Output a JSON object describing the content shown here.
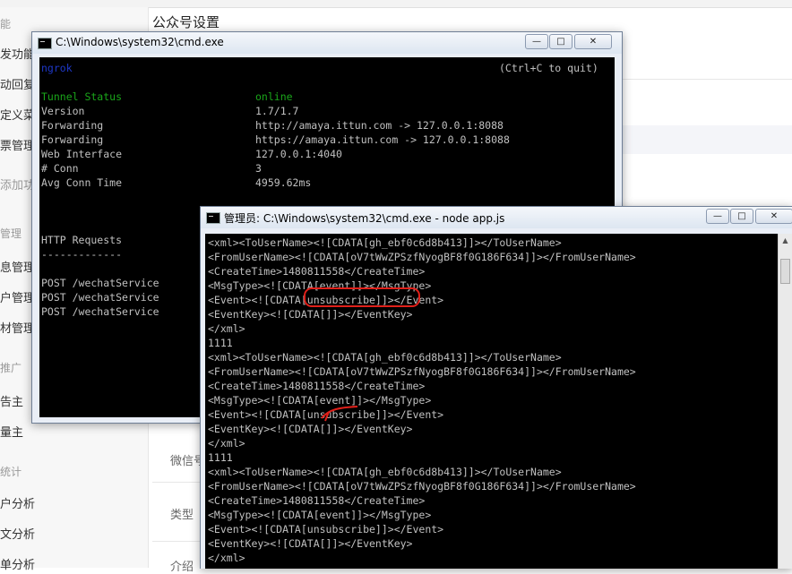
{
  "background": {
    "page_title": "公众号设置",
    "sidebar": {
      "items": [
        "能",
        "发功能",
        "动回复",
        "定义菜",
        "票管理",
        "添加功",
        "管理",
        "息管理",
        "户管理",
        "材管理",
        "推广",
        "告主",
        "量主",
        "统计",
        "户分析",
        "文分析",
        "单分析"
      ]
    },
    "fields": [
      "微信号",
      "类型",
      "介绍"
    ]
  },
  "ngrok_window": {
    "title": "C:\\Windows\\system32\\cmd.exe",
    "header_left": "ngrok",
    "header_right": "(Ctrl+C to quit)",
    "tunnel_status_label": "Tunnel Status",
    "tunnel_status_value": "online",
    "version_label": "Version",
    "version_value": "1.7/1.7",
    "forwarding_label_1": "Forwarding",
    "forwarding_value_1": "http://amaya.ittun.com -> 127.0.0.1:8088",
    "forwarding_label_2": "Forwarding",
    "forwarding_value_2": "https://amaya.ittun.com -> 127.0.0.1:8088",
    "web_interface_label": "Web Interface",
    "web_interface_value": "127.0.0.1:4040",
    "conn_label": "# Conn",
    "conn_value": "3",
    "avg_conn_label": "Avg Conn Time",
    "avg_conn_value": "4959.62ms",
    "http_requests_label": "HTTP Requests",
    "http_requests_rule": "-------------",
    "requests": [
      "POST /wechatService",
      "POST /wechatService",
      "POST /wechatService"
    ]
  },
  "node_window": {
    "title": "管理员: C:\\Windows\\system32\\cmd.exe - node  app.js",
    "lines": [
      "<xml><ToUserName><![CDATA[gh_ebf0c6d8b413]]></ToUserName>",
      "<FromUserName><![CDATA[oV7tWwZPSzfNyogBF8f0G186F634]]></FromUserName>",
      "<CreateTime>1480811558</CreateTime>",
      "<MsgType><![CDATA[event]]></MsgType>",
      "<Event><![CDATA[unsubscribe]]></Event>",
      "<EventKey><![CDATA[]]></EventKey>",
      "</xml>",
      "1111",
      "<xml><ToUserName><![CDATA[gh_ebf0c6d8b413]]></ToUserName>",
      "<FromUserName><![CDATA[oV7tWwZPSzfNyogBF8f0G186F634]]></FromUserName>",
      "<CreateTime>1480811558</CreateTime>",
      "<MsgType><![CDATA[event]]></MsgType>",
      "<Event><![CDATA[unsubscribe]]></Event>",
      "<EventKey><![CDATA[]]></EventKey>",
      "</xml>",
      "1111",
      "<xml><ToUserName><![CDATA[gh_ebf0c6d8b413]]></ToUserName>",
      "<FromUserName><![CDATA[oV7tWwZPSzfNyogBF8f0G186F634]]></FromUserName>",
      "<CreateTime>1480811558</CreateTime>",
      "<MsgType><![CDATA[event]]></MsgType>",
      "<Event><![CDATA[unsubscribe]]></Event>",
      "<EventKey><![CDATA[]]></EventKey>",
      "</xml>"
    ]
  },
  "window_buttons": {
    "minimize": "—",
    "maximize": "□",
    "close": "✕"
  },
  "colors": {
    "console_bg": "#000000",
    "console_text": "#c0c0c0",
    "status_green": "#1aa61a",
    "ngrok_blue": "#1e38c8",
    "annotation_red": "#e0201a"
  }
}
